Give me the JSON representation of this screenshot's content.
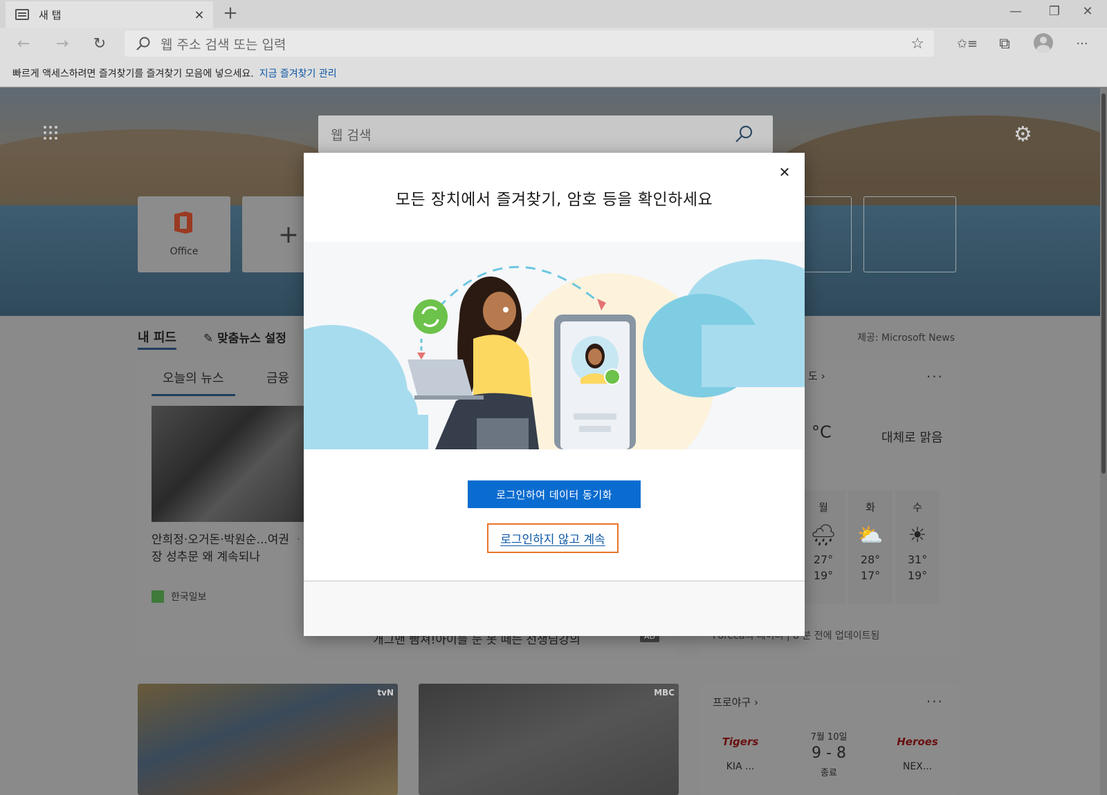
{
  "browser": {
    "tab_title": "새 탭",
    "tab_close_icon": "×",
    "new_tab_icon": "+",
    "window_controls": {
      "minimize": "—",
      "restore": "❐",
      "close": "✕"
    },
    "address_placeholder": "웹 주소 검색 또는 입력",
    "favorites_bar_message": "빠르게 액세스하려면 즐겨찾기를 즐겨찾기 모음에 넣으세요.",
    "favorites_bar_link": "지금 즐겨찾기 관리"
  },
  "toolbar_icons": {
    "back": "←",
    "forward": "→",
    "refresh": "↻",
    "favorite_star": "☆",
    "favorites_list": "✩≡",
    "collections": "⧉",
    "more": "···"
  },
  "ntp": {
    "search_placeholder": "웹 검색",
    "gear_icon": "⚙",
    "tiles": [
      {
        "label": "Office"
      },
      {
        "label": ""
      }
    ],
    "add_tile_glyph": "+",
    "feed_tab": "내 피드",
    "personalize_label": "✎ 맞춤뉴스 설정",
    "provider": "제공: Microsoft News"
  },
  "news": {
    "tabs": [
      "오늘의 뉴스",
      "금융"
    ],
    "headline": "안희정·오거돈·박원순...여권 ᆞ장 성추문 왜 계속되나",
    "source": "한국일보",
    "ad_text": "개그맨 빰쳐!아이들 눈 못 떼는 선생님강의",
    "ad_badge": "AD"
  },
  "weather": {
    "title": "도 ›",
    "more": "···",
    "unit": "°C",
    "condition": "대체로 맑음",
    "forecast": [
      {
        "day": "월",
        "icon": "🌧",
        "hi": "27°",
        "lo": "19°"
      },
      {
        "day": "화",
        "icon": "⛅",
        "hi": "28°",
        "lo": "17°"
      },
      {
        "day": "수",
        "icon": "☀",
        "hi": "31°",
        "lo": "19°"
      }
    ],
    "footer": "Foreca의 데이터 | 8 분 전에 업데이트됨"
  },
  "video_badges": [
    "tvN",
    "MBC"
  ],
  "baseball": {
    "title": "프로야구 ›",
    "more": "···",
    "home_logo": "Tigers",
    "home_team": "KIA ...",
    "away_logo": "Heroes",
    "away_team": "NEX...",
    "date": "7월 10일",
    "score": "9 - 8",
    "status": "종료"
  },
  "modal": {
    "close_icon": "✕",
    "title": "모든 장치에서 즐겨찾기, 암호 등을 확인하세요",
    "primary_button": "로그인하여 데이터 동기화",
    "secondary_button": "로그인하지 않고 계속"
  },
  "colors": {
    "primary_button": "#0a6cd0",
    "focus_outline": "#e8742a",
    "link": "#0b56a5"
  }
}
